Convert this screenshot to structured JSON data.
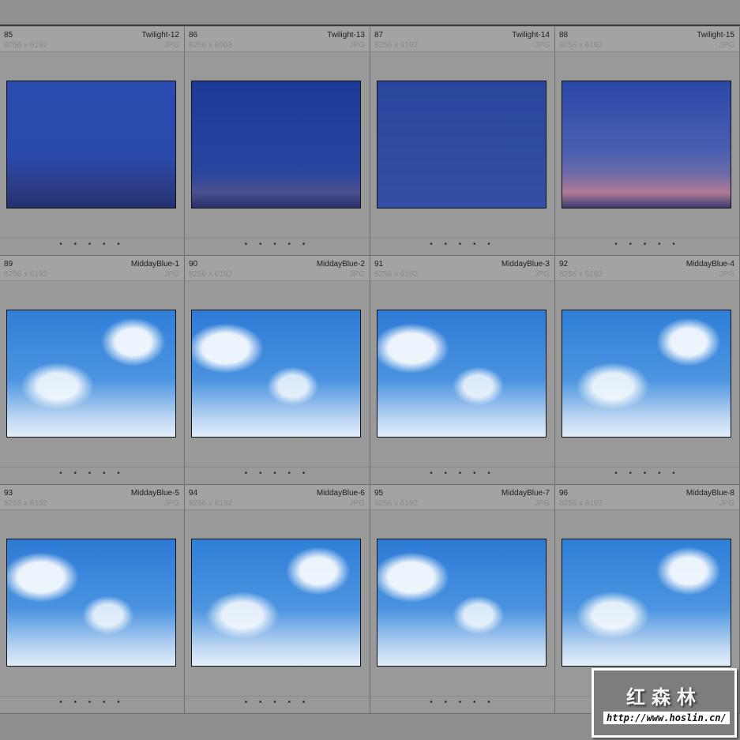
{
  "cells": [
    {
      "index": "85",
      "name": "Twilight-12",
      "dims": "8256 x 6192",
      "ext": "JPG",
      "style": "tw1"
    },
    {
      "index": "86",
      "name": "Twilight-13",
      "dims": "8256 x 6003",
      "ext": "JPG",
      "style": "tw2"
    },
    {
      "index": "87",
      "name": "Twilight-14",
      "dims": "8256 x 6192",
      "ext": "JPG",
      "style": "tw3"
    },
    {
      "index": "88",
      "name": "Twilight-15",
      "dims": "8256 x 6192",
      "ext": "JPG",
      "style": "tw4"
    },
    {
      "index": "89",
      "name": "MiddayBlue-1",
      "dims": "8256 x 6192",
      "ext": "JPG",
      "style": "sky"
    },
    {
      "index": "90",
      "name": "MiddayBlue-2",
      "dims": "8256 x 6192",
      "ext": "JPG",
      "style": "sky2"
    },
    {
      "index": "91",
      "name": "MiddayBlue-3",
      "dims": "8256 x 6192",
      "ext": "JPG",
      "style": "sky2"
    },
    {
      "index": "92",
      "name": "MiddayBlue-4",
      "dims": "8256 x 6192",
      "ext": "JPG",
      "style": "sky"
    },
    {
      "index": "93",
      "name": "MiddayBlue-5",
      "dims": "8256 x 6192",
      "ext": "JPG",
      "style": "sky2"
    },
    {
      "index": "94",
      "name": "MiddayBlue-6",
      "dims": "8256 x 6192",
      "ext": "JPG",
      "style": "sky"
    },
    {
      "index": "95",
      "name": "MiddayBlue-7",
      "dims": "8256 x 6192",
      "ext": "JPG",
      "style": "sky2"
    },
    {
      "index": "96",
      "name": "MiddayBlue-8",
      "dims": "8256 x 6192",
      "ext": "JPG",
      "style": "sky"
    }
  ],
  "rating_dots": "• • • • •",
  "watermark": {
    "title": "红森林",
    "url": "http://www.hoslin.cn/"
  }
}
